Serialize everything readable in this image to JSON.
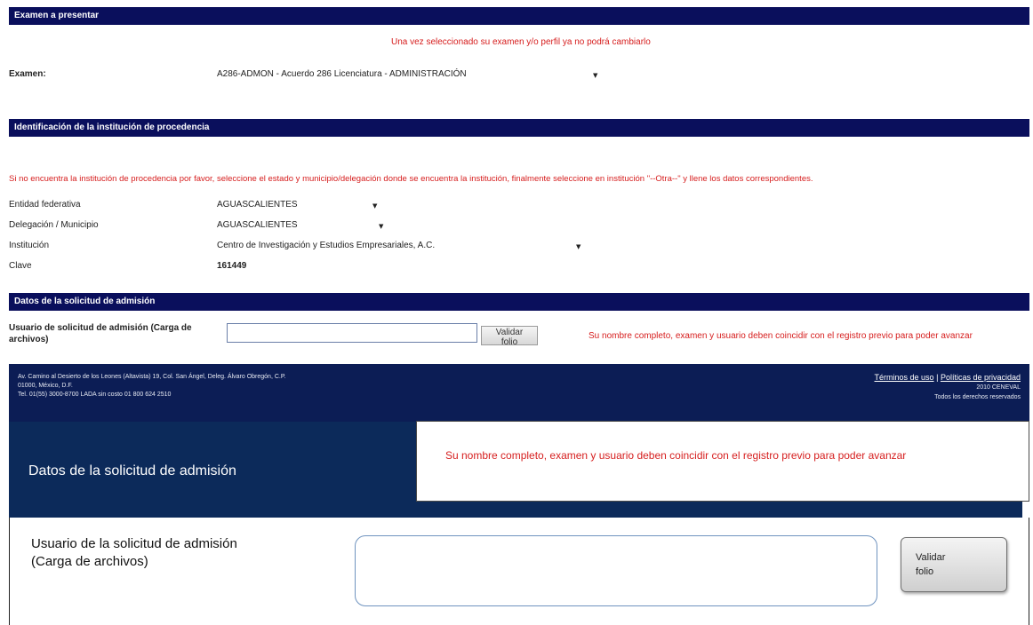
{
  "exam_section": {
    "header": "Examen a presentar",
    "warning": "Una vez seleccionado su examen y/o perfil ya no podrá cambiarlo",
    "exam_label": "Examen:",
    "exam_value": "A286-ADMON - Acuerdo 286 Licenciatura - ADMINISTRACIÓN"
  },
  "institution_section": {
    "header": "Identificación de la institución de procedencia",
    "instruction": "Si no encuentra la institución de procedencia por favor, seleccione el estado y municipio/delegación donde se encuentra la institución, finalmente seleccione en institución \"--Otra--\" y llene los datos correspondientes.",
    "fields": [
      {
        "label": "Entidad federativa",
        "value": "AGUASCALIENTES"
      },
      {
        "label": "Delegación / Municipio",
        "value": "AGUASCALIENTES"
      },
      {
        "label": "Institución",
        "value": "Centro de Investigación y Estudios Empresariales, A.C."
      },
      {
        "label": "Clave",
        "value": "161449"
      }
    ]
  },
  "admission_section": {
    "header": "Datos de la solicitud de admisión",
    "user_label": "Usuario de solicitud de admisión (Carga de archivos)",
    "button_label": "Validar folio",
    "note": "Su nombre completo, examen y usuario deben coincidir con el registro previo para poder avanzar"
  },
  "footer": {
    "address_line1": "Av. Camino al Desierto de los Leones (Altavista) 19, Col. San Ángel, Deleg. Álvaro Obregón, C.P.",
    "address_line2": "01000, México, D.F.",
    "address_line3": "Tel. 01(55) 3000-8700 LADA sin costo 01 800 624 2510",
    "terms_link": "Términos de uso",
    "separator": "|",
    "privacy_link": "Políticas de privacidad",
    "year_org": "2010 CENEVAL",
    "rights": "Todos los derechos reservados"
  },
  "zoom": {
    "title": "Datos de la solicitud de admisión",
    "note": "Su nombre completo, examen y usuario deben coincidir con el registro previo para poder avanzar",
    "user_label_line1": "Usuario de la solicitud de admisión",
    "user_label_line2": "(Carga de archivos)",
    "button_label": "Validar folio"
  },
  "icons": {
    "dropdown": "dropdown-arrow-icon"
  },
  "colors": {
    "header_bg": "#0a0f5c",
    "warning_red": "#d61d1d",
    "zoom_bg": "#0c2a5a"
  }
}
